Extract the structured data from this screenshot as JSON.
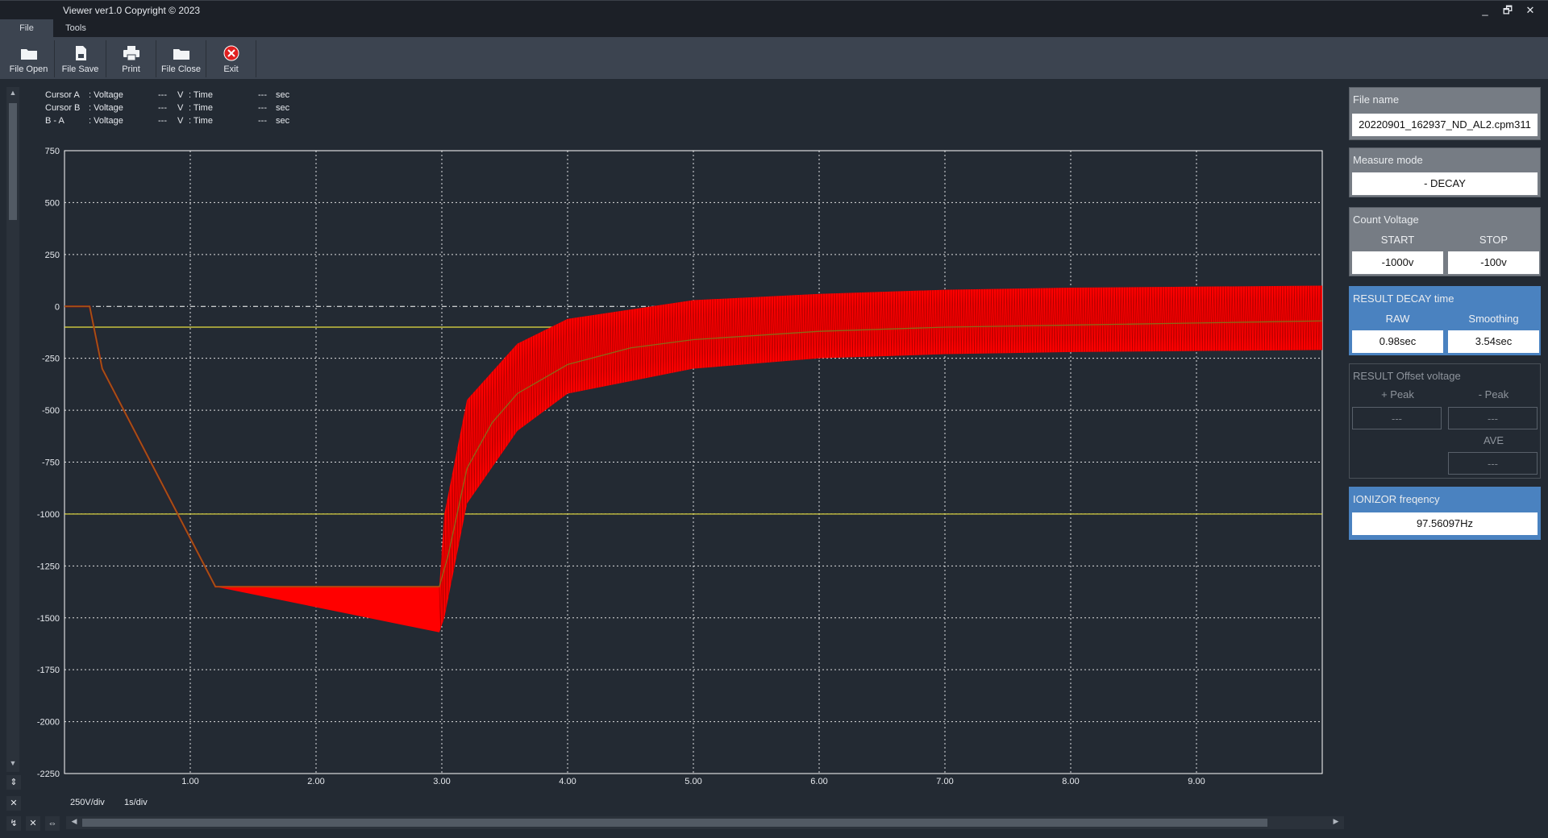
{
  "window": {
    "title": "Viewer ver1.0 Copyright © 2023",
    "buttons": {
      "minimize": "_",
      "restore": "🗗",
      "close": "✕"
    }
  },
  "menu": [
    {
      "label": "File",
      "active": true
    },
    {
      "label": "Tools",
      "active": false
    }
  ],
  "toolbar": {
    "file_open": "File Open",
    "file_save": "File Save",
    "print": "Print",
    "file_close": "File Close",
    "exit": "Exit"
  },
  "cursor_info": [
    {
      "name": "Cursor A",
      "q1": ": Voltage",
      "v": "---",
      "u1": "V",
      "q2": ": Time",
      "t": "---",
      "u2": "sec"
    },
    {
      "name": "Cursor B",
      "q1": ": Voltage",
      "v": "---",
      "u1": "V",
      "q2": ": Time",
      "t": "---",
      "u2": "sec"
    },
    {
      "name": "B - A",
      "q1": ": Voltage",
      "v": "---",
      "u1": "V",
      "q2": ": Time",
      "t": "---",
      "u2": "sec"
    }
  ],
  "scale": {
    "voltage": "250V/div",
    "time": "1s/div"
  },
  "chart_data": {
    "type": "line",
    "title": "",
    "xlabel": "",
    "ylabel": "",
    "xlim": [
      0,
      10
    ],
    "ylim": [
      -2250,
      750
    ],
    "grid": true,
    "y_ticks": [
      "750",
      "500",
      "250",
      "0",
      "-250",
      "-500",
      "-750",
      "-1000",
      "-1250",
      "-1500",
      "-1750",
      "-2000",
      "-2250"
    ],
    "x_ticks": [
      "1.00",
      "2.00",
      "3.00",
      "4.00",
      "5.00",
      "6.00",
      "7.00",
      "8.00",
      "9.00"
    ],
    "reference_lines": [
      {
        "y": -100,
        "color": "#e8e040"
      },
      {
        "y": -1000,
        "color": "#e8e040"
      }
    ],
    "series": [
      {
        "color": "#ff0000",
        "envelope": true,
        "upper": [
          [
            0,
            0
          ],
          [
            0.2,
            0
          ],
          [
            0.3,
            -300
          ],
          [
            1.2,
            -1350
          ],
          [
            2.98,
            -1350
          ],
          [
            3.02,
            -1000
          ],
          [
            3.2,
            -450
          ],
          [
            3.6,
            -180
          ],
          [
            4.0,
            -60
          ],
          [
            5.0,
            30
          ],
          [
            6.0,
            60
          ],
          [
            7.0,
            80
          ],
          [
            8.0,
            90
          ],
          [
            9.0,
            95
          ],
          [
            10.0,
            100
          ]
        ],
        "lower": [
          [
            0,
            0
          ],
          [
            0.2,
            0
          ],
          [
            0.3,
            -300
          ],
          [
            1.2,
            -1350
          ],
          [
            2.98,
            -1570
          ],
          [
            3.02,
            -1500
          ],
          [
            3.2,
            -950
          ],
          [
            3.6,
            -600
          ],
          [
            4.0,
            -420
          ],
          [
            5.0,
            -300
          ],
          [
            6.0,
            -250
          ],
          [
            7.0,
            -230
          ],
          [
            8.0,
            -220
          ],
          [
            9.0,
            -215
          ],
          [
            10.0,
            -210
          ]
        ]
      },
      {
        "color": "#8a6a18",
        "points": [
          [
            0,
            0
          ],
          [
            0.2,
            0
          ],
          [
            0.3,
            -300
          ],
          [
            1.2,
            -1350
          ],
          [
            2.98,
            -1350
          ],
          [
            3.05,
            -1200
          ],
          [
            3.2,
            -780
          ],
          [
            3.4,
            -560
          ],
          [
            3.6,
            -420
          ],
          [
            4.0,
            -280
          ],
          [
            4.5,
            -200
          ],
          [
            5.0,
            -160
          ],
          [
            6.0,
            -120
          ],
          [
            7.0,
            -100
          ],
          [
            8.0,
            -90
          ],
          [
            9.0,
            -80
          ],
          [
            10.0,
            -70
          ]
        ]
      }
    ]
  },
  "panels": {
    "file_name": {
      "title": "File name",
      "value": "20220901_162937_ND_AL2.cpm311"
    },
    "measure_mode": {
      "title": "Measure mode",
      "value": "- DECAY"
    },
    "count_voltage": {
      "title": "Count Voltage",
      "start_label": "START",
      "stop_label": "STOP",
      "start": "-1000v",
      "stop": "-100v"
    },
    "result_decay": {
      "title": "RESULT DECAY time",
      "raw_label": "RAW",
      "smooth_label": "Smoothing",
      "raw": "0.98sec",
      "smooth": "3.54sec"
    },
    "result_offset": {
      "title": "RESULT Offset voltage",
      "plus_label": "+ Peak",
      "minus_label": "- Peak",
      "ave_label": "AVE",
      "plus": "---",
      "minus": "---",
      "ave": "---"
    },
    "ionizor": {
      "title": "IONIZOR freqency",
      "value": "97.56097Hz"
    }
  },
  "colors": {
    "background": "#232a33",
    "grid": "#ffffff",
    "signal": "#ff0000",
    "reference": "#e8e040",
    "accent_panel": "#4a82c0"
  }
}
